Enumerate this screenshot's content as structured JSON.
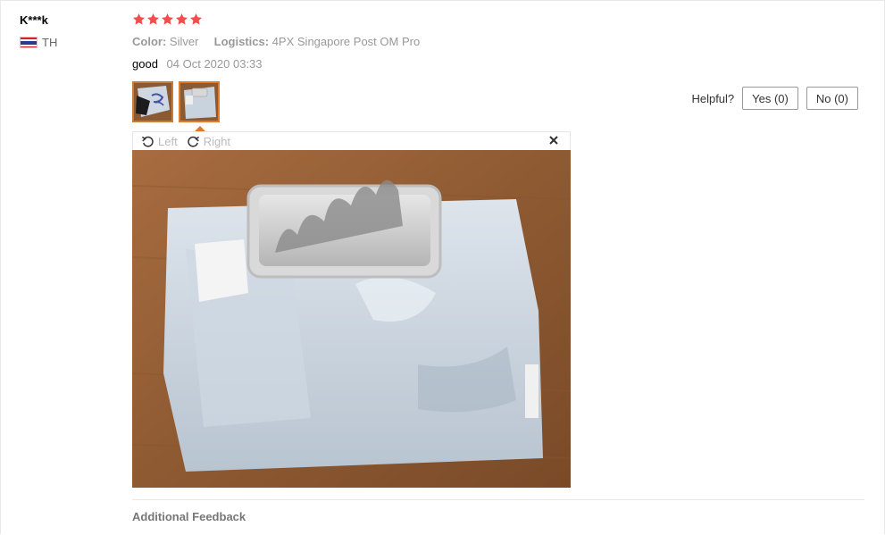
{
  "review": {
    "user_name": "K***k",
    "country_code": "TH",
    "rating": 5,
    "attributes": [
      {
        "key": "Color:",
        "value": "Silver"
      },
      {
        "key": "Logistics:",
        "value": "4PX Singapore Post OM Pro"
      }
    ],
    "content": "good",
    "date": "04 Oct 2020 03:33",
    "thumbnail_count": 2,
    "active_thumbnail": 2
  },
  "helpful": {
    "label": "Helpful?",
    "yes_label": "Yes (0)",
    "no_label": "No (0)"
  },
  "viewer": {
    "rotate_left_label": "Left",
    "rotate_right_label": "Right",
    "close_icon": "close-icon"
  },
  "additional_feedback_label": "Additional Feedback",
  "colors": {
    "star": "#f04d4d",
    "thumb_active_border": "#e07a2c",
    "muted_text": "#999999",
    "wood_background": "#9a6238",
    "package_bag": "#c9d3dd"
  }
}
